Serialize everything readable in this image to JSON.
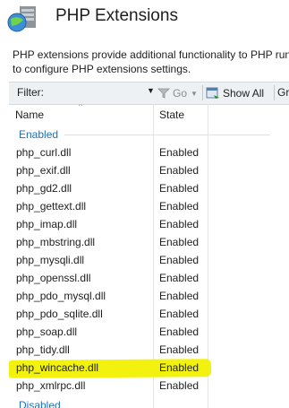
{
  "header": {
    "title": "PHP Extensions",
    "icon": "php-manager-icon"
  },
  "description": "PHP extensions provide additional functionality to PHP run\nto configure PHP extensions settings.",
  "toolbar": {
    "filter_label": "Filter:",
    "filter_value": "",
    "go_label": "Go",
    "show_all_label": "Show All",
    "group_by_label": "Gr"
  },
  "columns": {
    "name": "Name",
    "state": "State"
  },
  "groups": {
    "enabled": "Enabled",
    "disabled": "Disabled"
  },
  "rows": [
    {
      "name": "php_curl.dll",
      "state": "Enabled"
    },
    {
      "name": "php_exif.dll",
      "state": "Enabled"
    },
    {
      "name": "php_gd2.dll",
      "state": "Enabled"
    },
    {
      "name": "php_gettext.dll",
      "state": "Enabled"
    },
    {
      "name": "php_imap.dll",
      "state": "Enabled"
    },
    {
      "name": "php_mbstring.dll",
      "state": "Enabled"
    },
    {
      "name": "php_mysqli.dll",
      "state": "Enabled"
    },
    {
      "name": "php_openssl.dll",
      "state": "Enabled"
    },
    {
      "name": "php_pdo_mysql.dll",
      "state": "Enabled"
    },
    {
      "name": "php_pdo_sqlite.dll",
      "state": "Enabled"
    },
    {
      "name": "php_soap.dll",
      "state": "Enabled"
    },
    {
      "name": "php_tidy.dll",
      "state": "Enabled"
    },
    {
      "name": "php_wincache.dll",
      "state": "Enabled",
      "highlighted": true
    },
    {
      "name": "php_xmlrpc.dll",
      "state": "Enabled"
    }
  ],
  "colors": {
    "highlight": "#f2f20e",
    "group_text": "#1e6fb8"
  }
}
